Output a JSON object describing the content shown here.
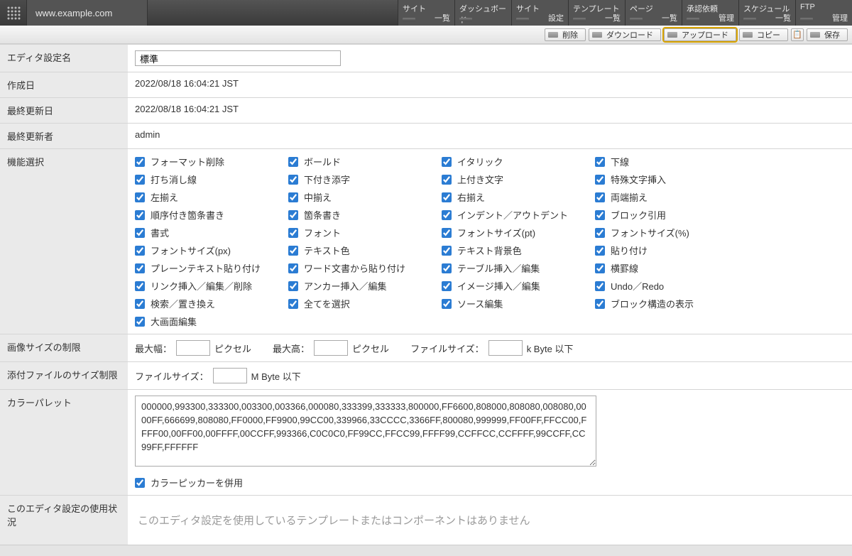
{
  "topbar": {
    "url": "www.example.com",
    "nav": [
      {
        "title": "サイト",
        "sub": "一覧"
      },
      {
        "title": "ダッシュボード",
        "sub": ""
      },
      {
        "title": "サイト",
        "sub": "設定"
      },
      {
        "title": "テンプレート",
        "sub": "一覧"
      },
      {
        "title": "ページ",
        "sub": "一覧"
      },
      {
        "title": "承認依頼",
        "sub": "管理"
      },
      {
        "title": "スケジュール",
        "sub": "一覧"
      },
      {
        "title": "FTP",
        "sub": "管理"
      }
    ]
  },
  "actionbar": {
    "delete": "削除",
    "download": "ダウンロード",
    "upload": "アップロード",
    "copy": "コピー",
    "save": "保存"
  },
  "labels": {
    "editor_name": "エディタ設定名",
    "created_at": "作成日",
    "updated_at": "最終更新日",
    "updated_by": "最終更新者",
    "features": "機能選択",
    "image_size": "画像サイズの制限",
    "attach_size": "添付ファイルのサイズ制限",
    "color_palette": "カラーパレット",
    "usage": "このエディタ設定の使用状況"
  },
  "values": {
    "editor_name": "標準",
    "created_at": "2022/08/18 16:04:21 JST",
    "updated_at": "2022/08/18 16:04:21 JST",
    "updated_by": "admin",
    "max_width": "",
    "max_height": "",
    "file_kb": "",
    "file_mb": "",
    "colors": "000000,993300,333300,003300,003366,000080,333399,333333,800000,FF6600,808000,808080,008080,0000FF,666699,808080,FF0000,FF9900,99CC00,339966,33CCCC,3366FF,800080,999999,FF00FF,FFCC00,FFFF00,00FF00,00FFFF,00CCFF,993366,C0C0C0,FF99CC,FFCC99,FFFF99,CCFFCC,CCFFFF,99CCFF,CC99FF,FFFFFF",
    "color_picker": true,
    "usage_empty": "このエディタ設定を使用しているテンプレートまたはコンポーネントはありません"
  },
  "image_size_text": {
    "max_w": "最大幅：",
    "px": "ピクセル",
    "max_h": "最大高：",
    "fsize": "ファイルサイズ：",
    "kb_suffix": "k Byte 以下"
  },
  "attach_size_text": {
    "fsize": "ファイルサイズ：",
    "mb_suffix": "M Byte 以下"
  },
  "color_picker_label": "カラーピッカーを併用",
  "features": [
    {
      "label": "フォーマット削除",
      "checked": true
    },
    {
      "label": "ボールド",
      "checked": true
    },
    {
      "label": "イタリック",
      "checked": true
    },
    {
      "label": "下線",
      "checked": true
    },
    {
      "label": "打ち消し線",
      "checked": true
    },
    {
      "label": "下付き添字",
      "checked": true
    },
    {
      "label": "上付き文字",
      "checked": true
    },
    {
      "label": "特殊文字挿入",
      "checked": true
    },
    {
      "label": "左揃え",
      "checked": true
    },
    {
      "label": "中揃え",
      "checked": true
    },
    {
      "label": "右揃え",
      "checked": true
    },
    {
      "label": "両端揃え",
      "checked": true
    },
    {
      "label": "順序付き箇条書き",
      "checked": true
    },
    {
      "label": "箇条書き",
      "checked": true
    },
    {
      "label": "インデント／アウトデント",
      "checked": true
    },
    {
      "label": "ブロック引用",
      "checked": true
    },
    {
      "label": "書式",
      "checked": true
    },
    {
      "label": "フォント",
      "checked": true
    },
    {
      "label": "フォントサイズ(pt)",
      "checked": true
    },
    {
      "label": "フォントサイズ(%)",
      "checked": true
    },
    {
      "label": "フォントサイズ(px)",
      "checked": true
    },
    {
      "label": "テキスト色",
      "checked": true
    },
    {
      "label": "テキスト背景色",
      "checked": true
    },
    {
      "label": "貼り付け",
      "checked": true
    },
    {
      "label": "プレーンテキスト貼り付け",
      "checked": true
    },
    {
      "label": "ワード文書から貼り付け",
      "checked": true
    },
    {
      "label": "テーブル挿入／編集",
      "checked": true
    },
    {
      "label": "横罫線",
      "checked": true
    },
    {
      "label": "リンク挿入／編集／削除",
      "checked": true
    },
    {
      "label": "アンカー挿入／編集",
      "checked": true
    },
    {
      "label": "イメージ挿入／編集",
      "checked": true
    },
    {
      "label": "Undo／Redo",
      "checked": true
    },
    {
      "label": "検索／置き換え",
      "checked": true
    },
    {
      "label": "全てを選択",
      "checked": true
    },
    {
      "label": "ソース編集",
      "checked": true
    },
    {
      "label": "ブロック構造の表示",
      "checked": true
    },
    {
      "label": "大画面編集",
      "checked": true
    }
  ]
}
